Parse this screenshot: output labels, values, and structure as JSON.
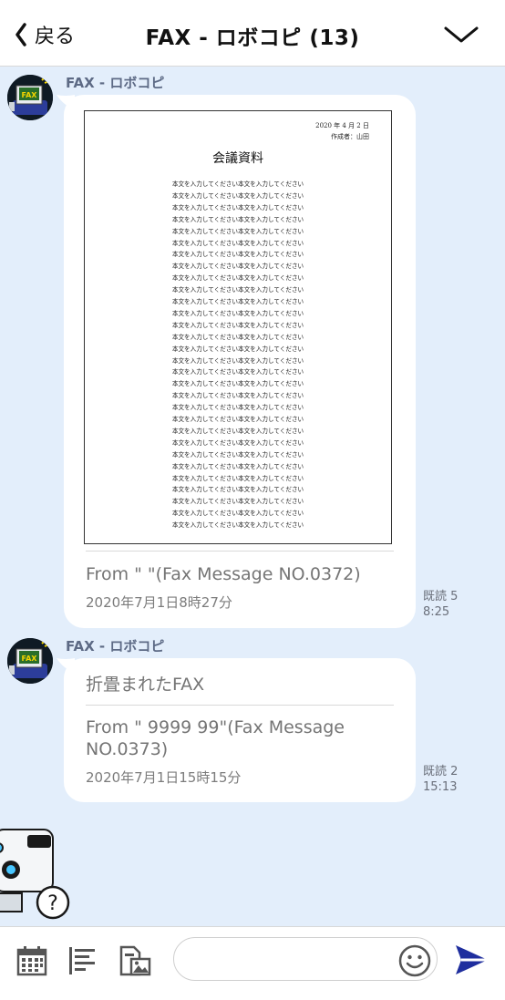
{
  "header": {
    "back_label": "戻る",
    "title": "FAX - ロボコピ (13)"
  },
  "messages": [
    {
      "sender": "FAX - ロボコピ",
      "document": {
        "date": "2020 年 4 月 2 日",
        "author": "作成者：山田",
        "title": "会議資料",
        "body_line": "本文を入力してください本文を入力してください"
      },
      "from": "From \" \"(Fax Message NO.0372)",
      "date": "2020年7月1日8時27分",
      "read": "既読 5",
      "time": "8:25"
    },
    {
      "sender": "FAX - ロボコピ",
      "folded": "折畳まれたFAX",
      "from_line1": "From \" 9999 99\"(Fax Message",
      "from_line2": "NO.0373)",
      "date": "2020年7月1日15時15分",
      "read": "既読 2",
      "time": "15:13"
    }
  ],
  "avatar_label": "FAX",
  "help_symbol": "?",
  "input": {
    "placeholder": ""
  },
  "colors": {
    "background": "#e3eefb",
    "accent": "#1f2e9e",
    "sender": "#5d6a85"
  }
}
